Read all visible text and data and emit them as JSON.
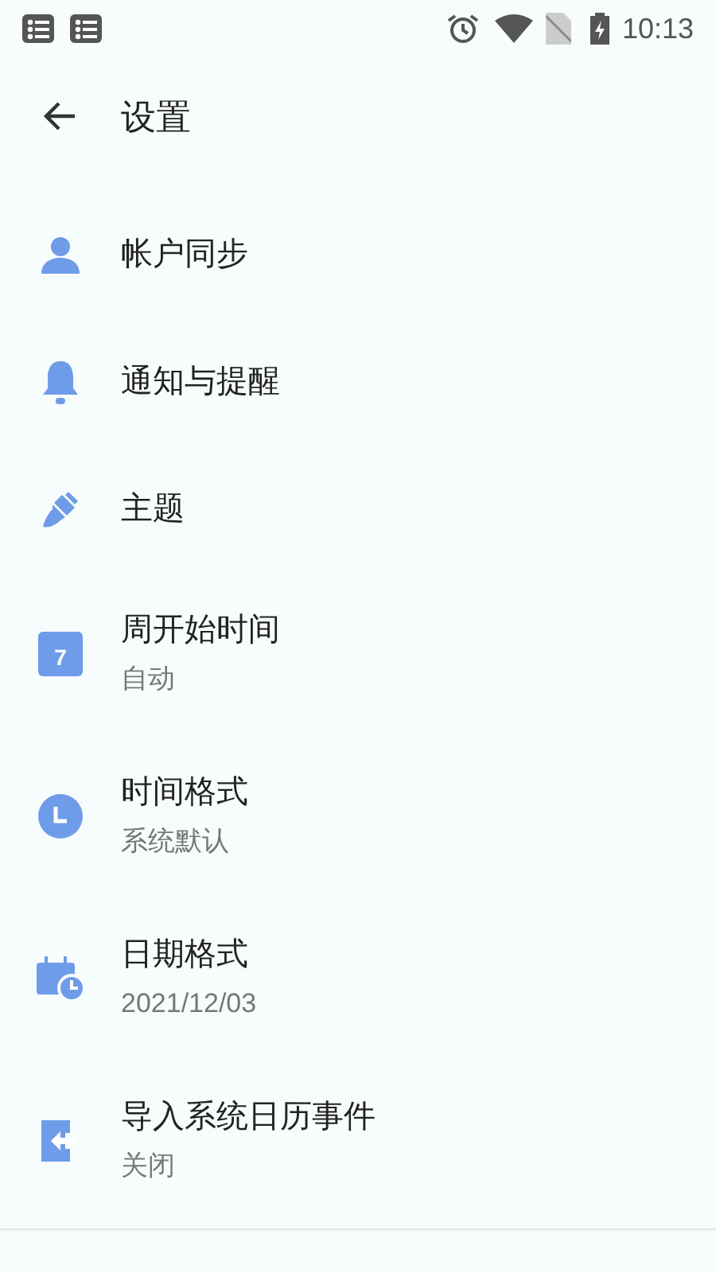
{
  "status_bar": {
    "time": "10:13"
  },
  "toolbar": {
    "title": "设置"
  },
  "items": [
    {
      "title": "帐户同步"
    },
    {
      "title": "通知与提醒"
    },
    {
      "title": "主题"
    },
    {
      "title": "周开始时间",
      "subtitle": "自动",
      "icon_text": "7"
    },
    {
      "title": "时间格式",
      "subtitle": "系统默认"
    },
    {
      "title": "日期格式",
      "subtitle": "2021/12/03"
    },
    {
      "title": "导入系统日历事件",
      "subtitle": "关闭"
    }
  ]
}
